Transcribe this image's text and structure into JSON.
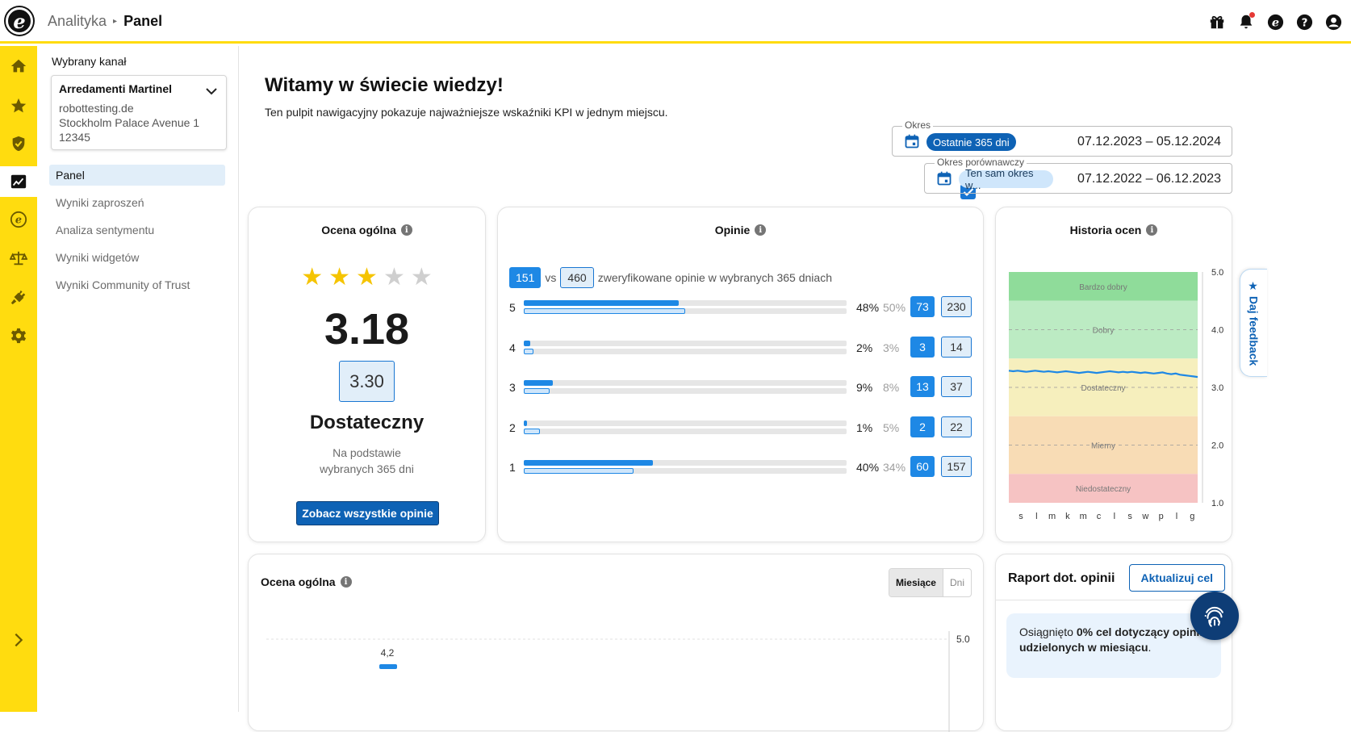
{
  "header": {
    "logo_letter": "e",
    "breadcrumb_parent": "Analityka",
    "breadcrumb_sep": "▸",
    "breadcrumb_current": "Panel",
    "icons": [
      "gift-icon",
      "bell-icon",
      "trusted-logo-icon",
      "help-icon",
      "account-icon"
    ]
  },
  "rail": {
    "items": [
      "home-icon",
      "star-icon",
      "shield-check-icon",
      "analytics-icon",
      "trusted-e-icon",
      "scales-icon",
      "plug-icon",
      "gear-icon"
    ],
    "active": "analytics-icon",
    "expand_icon": "chevron-right-icon"
  },
  "sidebar": {
    "channel_label": "Wybrany kanał",
    "channel": {
      "name": "Arredamenti Martinel",
      "domain": "robottesting.de",
      "address": "Stockholm Palace Avenue 1",
      "zip": "12345"
    },
    "nav": [
      {
        "label": "Panel",
        "active": true
      },
      {
        "label": "Wyniki zaproszeń",
        "active": false
      },
      {
        "label": "Analiza sentymentu",
        "active": false
      },
      {
        "label": "Wyniki widgetów",
        "active": false
      },
      {
        "label": "Wyniki Community of Trust",
        "active": false
      }
    ]
  },
  "main": {
    "title": "Witamy w świecie wiedzy!",
    "subtitle": "Ten pulpit nawigacyjny pokazuje najważniejsze wskaźniki KPI w jednym miejscu.",
    "period": {
      "label": "Okres",
      "chip": "Ostatnie 365 dni",
      "range": "07.12.2023 – 05.12.2024"
    },
    "compare_period": {
      "label": "Okres porównawczy",
      "chip": "Ten sam okres w...",
      "range": "07.12.2022 – 06.12.2023",
      "checked": true
    }
  },
  "overall": {
    "title": "Ocena ogólna",
    "stars_filled": 3,
    "stars_total": 5,
    "score": "3.18",
    "compare_score": "3.30",
    "grade": "Dostateczny",
    "basis_line1": "Na podstawie",
    "basis_line2": "wybranych 365 dni",
    "button": "Zobacz wszystkie opinie"
  },
  "opinions": {
    "title": "Opinie",
    "count_current": "151",
    "vs": "vs",
    "count_compare": "460",
    "summary_text": "zweryfikowane opinie w wybranych 365 dniach",
    "rows": [
      {
        "stars": "5",
        "pct": "48%",
        "pct_cmp": "50%",
        "fill": 0.48,
        "fill_cmp": 0.5,
        "count": "73",
        "count_cmp": "230"
      },
      {
        "stars": "4",
        "pct": "2%",
        "pct_cmp": "3%",
        "fill": 0.02,
        "fill_cmp": 0.03,
        "count": "3",
        "count_cmp": "14"
      },
      {
        "stars": "3",
        "pct": "9%",
        "pct_cmp": "8%",
        "fill": 0.09,
        "fill_cmp": 0.08,
        "count": "13",
        "count_cmp": "37"
      },
      {
        "stars": "2",
        "pct": "1%",
        "pct_cmp": "5%",
        "fill": 0.01,
        "fill_cmp": 0.05,
        "count": "2",
        "count_cmp": "22"
      },
      {
        "stars": "1",
        "pct": "40%",
        "pct_cmp": "34%",
        "fill": 0.4,
        "fill_cmp": 0.34,
        "count": "60",
        "count_cmp": "157"
      }
    ]
  },
  "history": {
    "title": "Historia ocen",
    "bands": [
      {
        "label": "Bardzo dobry",
        "from": 4.5,
        "to": 5.0,
        "color": "#8fdc9a"
      },
      {
        "label": "Dobry",
        "from": 3.5,
        "to": 4.5,
        "color": "#bcebc3"
      },
      {
        "label": "Dostateczny",
        "from": 2.5,
        "to": 3.5,
        "color": "#f6efbd"
      },
      {
        "label": "Mierny",
        "from": 1.5,
        "to": 2.5,
        "color": "#f8dcb5"
      },
      {
        "label": "Niedostateczny",
        "from": 1.0,
        "to": 1.5,
        "color": "#f6c3c3"
      }
    ],
    "y_ticks": [
      "5.0",
      "4.0",
      "3.0",
      "2.0",
      "1.0"
    ],
    "x_ticks": [
      "s",
      "l",
      "m",
      "k",
      "m",
      "c",
      "l",
      "s",
      "w",
      "p",
      "l",
      "g"
    ],
    "series": [
      3.29,
      3.28,
      3.29,
      3.28,
      3.27,
      3.28,
      3.29,
      3.28,
      3.27,
      3.28,
      3.27,
      3.26,
      3.27,
      3.28,
      3.27,
      3.26,
      3.25,
      3.26,
      3.27,
      3.26,
      3.25,
      3.26,
      3.27,
      3.28,
      3.27,
      3.26,
      3.27,
      3.26,
      3.27,
      3.26,
      3.25,
      3.26,
      3.25,
      3.24,
      3.25,
      3.26,
      3.24,
      3.23,
      3.24,
      3.22,
      3.21,
      3.2,
      3.19,
      3.18
    ],
    "line_color": "#1e88e5"
  },
  "monthly": {
    "title": "Ocena ogólna",
    "toggle_months": "Miesiące",
    "toggle_days": "Dni",
    "y_top": "5.0",
    "first_value": "4,2"
  },
  "report": {
    "title": "Raport dot. opinii",
    "button": "Aktualizuj cel",
    "goal_prefix": "Osiągnięto ",
    "goal_bold": "0% cel dotyczący opinii udzielonych w miesiącu",
    "goal_suffix": "."
  },
  "feedback_tab": "★ Daj feedback",
  "colors": {
    "accent_yellow": "#ffdc0f",
    "primary_blue": "#0e62b5",
    "bar_blue": "#1e88e5",
    "star_gold": "#f5c400"
  }
}
